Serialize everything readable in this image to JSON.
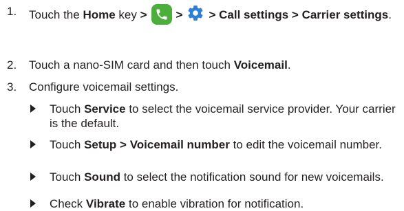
{
  "steps": [
    {
      "num": "1.",
      "parts": [
        {
          "t": "text",
          "v": "Touch the "
        },
        {
          "t": "bold",
          "v": "Home"
        },
        {
          "t": "text",
          "v": " key "
        },
        {
          "t": "bold",
          "v": ">"
        },
        {
          "t": "icon",
          "name": "phone-app-icon"
        },
        {
          "t": "bold",
          "v": ">"
        },
        {
          "t": "icon",
          "name": "settings-gear-icon"
        },
        {
          "t": "bold",
          "v": "> Call settings > Carrier settings"
        },
        {
          "t": "text",
          "v": "."
        }
      ]
    },
    {
      "num": "2.",
      "parts": [
        {
          "t": "text",
          "v": "Touch a nano-SIM card and then touch "
        },
        {
          "t": "bold",
          "v": "Voicemail"
        },
        {
          "t": "text",
          "v": "."
        }
      ]
    },
    {
      "num": "3.",
      "parts": [
        {
          "t": "text",
          "v": "Configure voicemail settings."
        }
      ]
    }
  ],
  "bullets": [
    {
      "parts": [
        {
          "t": "text",
          "v": "Touch "
        },
        {
          "t": "bold",
          "v": "Service"
        },
        {
          "t": "text",
          "v": " to select the voicemail service provider. Your carrier is the default."
        }
      ]
    },
    {
      "parts": [
        {
          "t": "text",
          "v": "Touch "
        },
        {
          "t": "bold",
          "v": "Setup > Voicemail number"
        },
        {
          "t": "text",
          "v": " to edit the voicemail number."
        }
      ]
    },
    {
      "parts": [
        {
          "t": "text",
          "v": "Touch "
        },
        {
          "t": "bold",
          "v": "Sound"
        },
        {
          "t": "text",
          "v": " to select the notification sound for new voicemails."
        }
      ]
    },
    {
      "parts": [
        {
          "t": "text",
          "v": "Check "
        },
        {
          "t": "bold",
          "v": "Vibrate"
        },
        {
          "t": "text",
          "v": " to enable vibration for notification."
        }
      ]
    }
  ],
  "colors": {
    "text": "#231f20",
    "phone_icon_bg": "#4caf3c",
    "gear_icon": "#2e7fd6"
  }
}
